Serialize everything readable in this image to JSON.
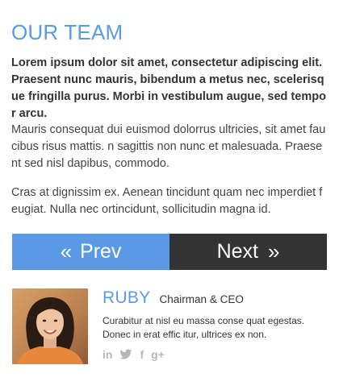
{
  "section": {
    "title": "OUR TEAM",
    "lead": "Lorem ipsum dolor sit amet, consectetur adipiscing elit. Praesent nunc mauris, bibendum a metus nec, scelerisque fringilla purus. Morbi in vestibulum augue, sed tempor arcu.",
    "paragraphs": [
      "Mauris consequat dui euismod dolorrus ultricies, sit amet faucibus risus mattis. n sagittis non nunc et malesuada. Praesent sed nisl dapibus, commodo.",
      "Cras at dignissim ex. Aenean tincidunt quam nec imperdiet feugiat. Nulla nec ortincidunt, sollicitudin magna id."
    ]
  },
  "nav": {
    "prev_label": "Prev",
    "next_label": "Next",
    "prev_icon": "double-chevron-left-icon",
    "next_icon": "double-chevron-right-icon",
    "prev_color": "#5a9ae5",
    "next_color": "#333333"
  },
  "member": {
    "name": "RUBY",
    "role": "Chairman & CEO",
    "bio": "Curabitur at nisl eu massa conse quat egestas. Donec in erat effic itur, ultrices ex non.",
    "photo": "portrait-photo",
    "socials": [
      {
        "icon": "linkedin-icon",
        "glyph": "in"
      },
      {
        "icon": "twitter-icon"
      },
      {
        "icon": "facebook-icon",
        "glyph": "f"
      },
      {
        "icon": "google-plus-icon",
        "glyph": "g+"
      }
    ]
  },
  "colors": {
    "accent": "#5b9be6",
    "dark": "#333333",
    "social_gray": "#b7b7b7"
  }
}
